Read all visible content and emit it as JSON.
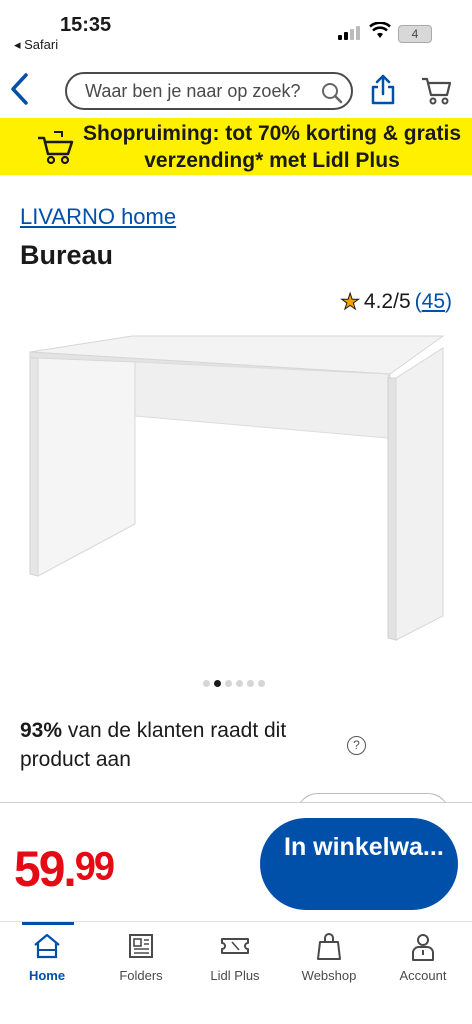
{
  "status": {
    "time": "15:35",
    "back_app": "◂ Safari",
    "battery": "4"
  },
  "header": {
    "search_placeholder": "Waar ben je naar op zoek?",
    "icons": [
      "back-icon",
      "search-icon",
      "share-icon",
      "cart-icon"
    ]
  },
  "banner": {
    "text": "Shopruiming: tot 70% korting & gratis verzending* met Lidl Plus",
    "bg_color": "#fff000"
  },
  "product": {
    "brand": "LIVARNO home",
    "title": "Bureau",
    "rating_star": "★",
    "rating": "4.2/5",
    "review_open": "(",
    "review_count": "45",
    "review_close": ")",
    "image_count": 6,
    "active_image": 1,
    "recommend_pct": "93%",
    "recommend_text": " van de klanten raadt dit product aan",
    "help_label": "?"
  },
  "pricebar": {
    "price": "59.99",
    "add_to_cart_label": "In winkelwa...",
    "price_color": "#e60a14",
    "button_color": "#0050aa"
  },
  "tabs": [
    {
      "label": "Home",
      "icon": "home-icon",
      "active": true
    },
    {
      "label": "Folders",
      "icon": "folders-icon",
      "active": false
    },
    {
      "label": "Lidl Plus",
      "icon": "lidl-plus-icon",
      "active": false
    },
    {
      "label": "Webshop",
      "icon": "webshop-icon",
      "active": false
    },
    {
      "label": "Account",
      "icon": "account-icon",
      "active": false
    }
  ]
}
